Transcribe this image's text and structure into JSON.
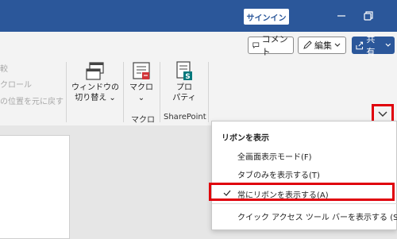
{
  "titlebar": {
    "signin_label": "サインイン"
  },
  "commandbar": {
    "comment_label": "コメント",
    "edit_label": "編集",
    "share_label": "共有"
  },
  "ribbon": {
    "faded_items": [
      "較",
      "クロール",
      "の位置を元に戻す"
    ],
    "window_switch_label_1": "ウィンドウの",
    "window_switch_label_2": "切り替え",
    "macro_label": "マクロ",
    "properties_label_1": "プロ",
    "properties_label_2": "パティ",
    "group_macro": "マクロ",
    "group_sharepoint": "SharePoint"
  },
  "ribbon_menu": {
    "title": "リボンを表示",
    "items": [
      {
        "label": "全画面表示モード(F)",
        "checked": false
      },
      {
        "label": "タブのみを表示する(T)",
        "checked": false
      },
      {
        "label": "常にリボンを表示する(A)",
        "checked": true
      },
      {
        "label": "クイック アクセス ツール バーを表示する (S)",
        "checked": false
      }
    ]
  },
  "colors": {
    "brand": "#2b579a",
    "highlight": "#e0000b"
  }
}
